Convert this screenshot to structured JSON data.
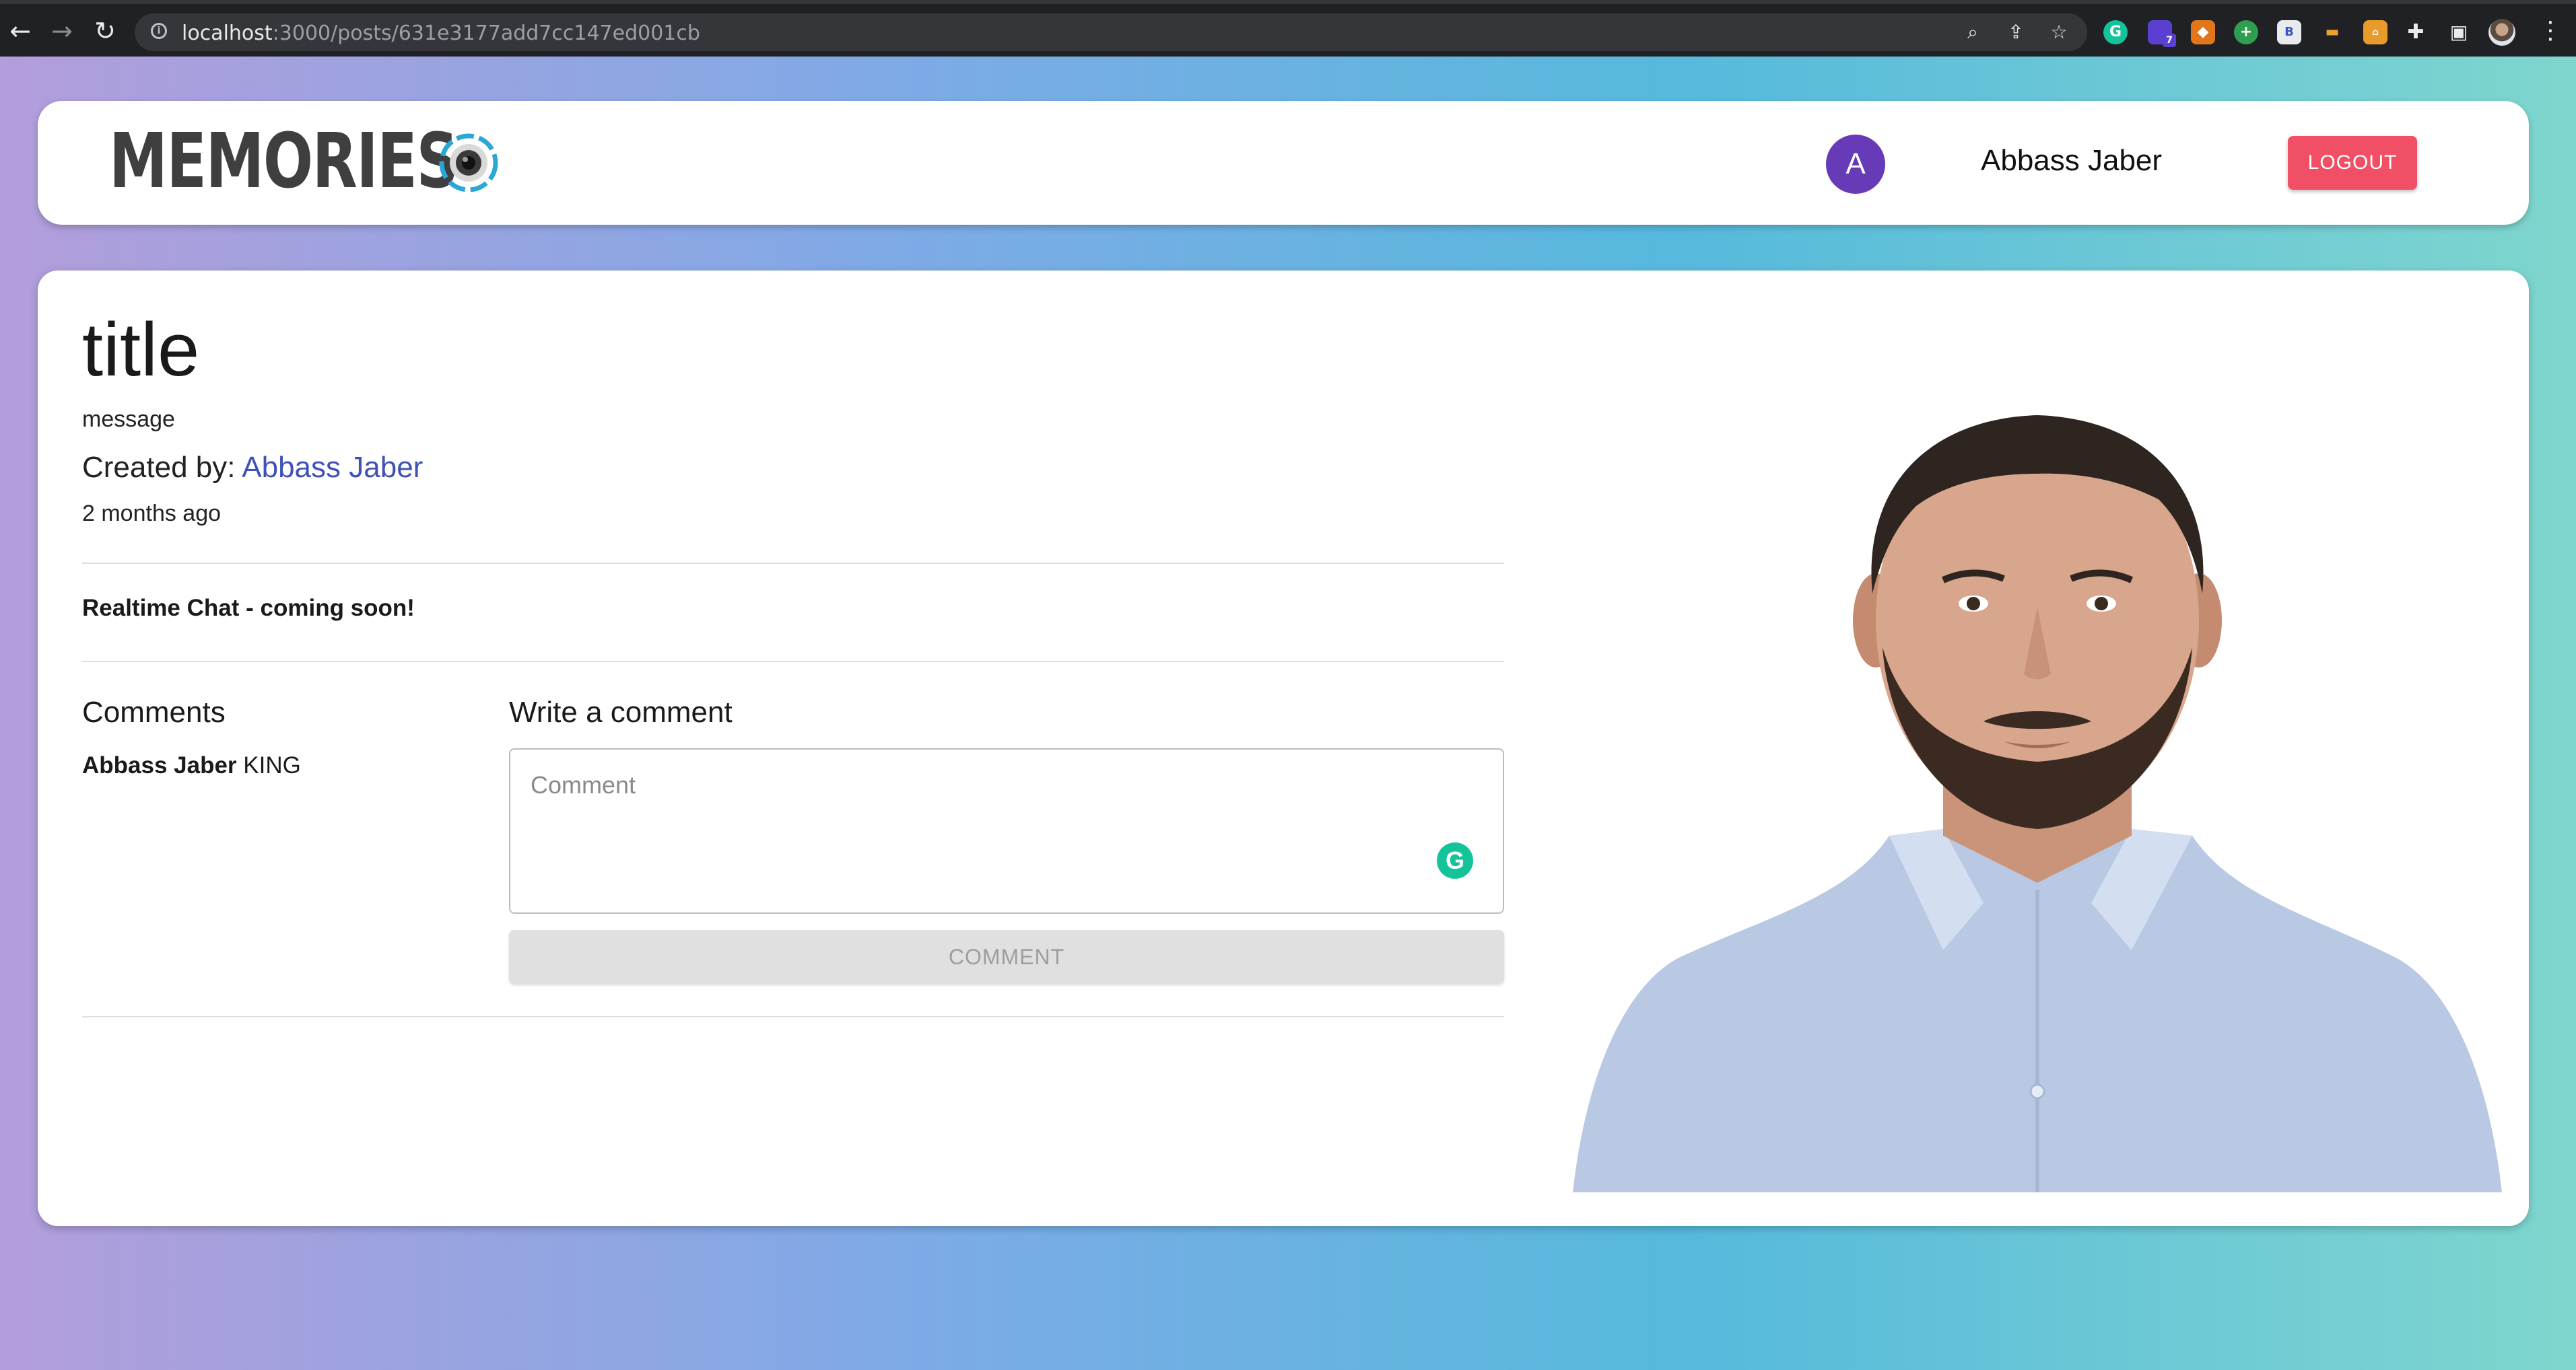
{
  "browser": {
    "url_host": "localhost",
    "url_path": ":3000/posts/631e3177add7cc147ed001cb",
    "extension_badge": "7"
  },
  "appbar": {
    "brand": "MEMORIES",
    "avatar_letter": "A",
    "username": "Abbass Jaber",
    "logout_label": "LOGOUT"
  },
  "post": {
    "title": "title",
    "message": "message",
    "created_by_label": "Created by: ",
    "author": "Abbass Jaber",
    "time_ago": "2 months ago",
    "chat_note": "Realtime Chat - coming soon!"
  },
  "comments": {
    "heading": "Comments",
    "items": [
      {
        "author": "Abbass Jaber",
        "text": "KING"
      }
    ]
  },
  "write_comment": {
    "heading": "Write a comment",
    "placeholder": "Comment",
    "button_label": "COMMENT"
  },
  "colors": {
    "accent_purple": "#673ab7",
    "logout_red": "#f04f66",
    "author_link": "#3f51b5",
    "grammarly_green": "#15c39a"
  }
}
